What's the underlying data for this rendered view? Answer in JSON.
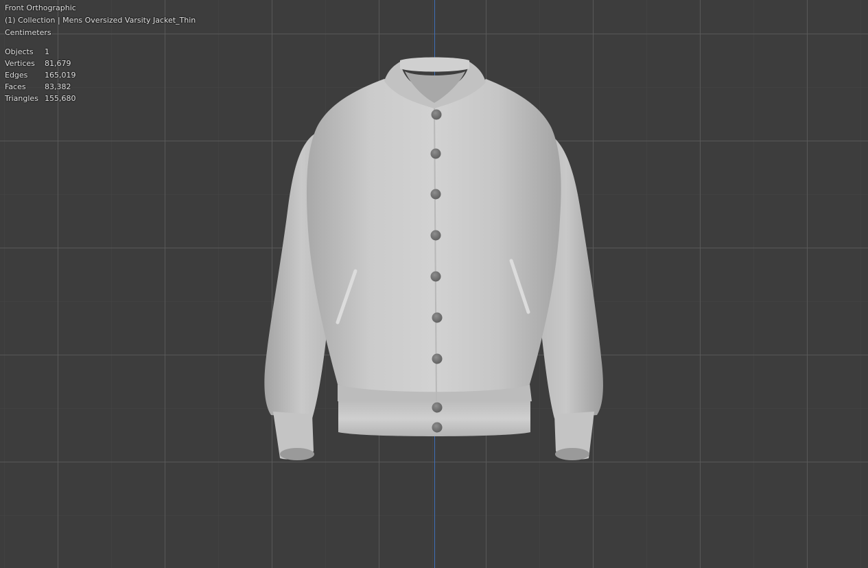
{
  "viewport": {
    "view_name": "Front Orthographic",
    "collection_line": "(1) Collection | Mens Oversized Varsity Jacket_Thin",
    "units": "Centimeters",
    "stats": [
      {
        "label": "Objects",
        "value": "1"
      },
      {
        "label": "Vertices",
        "value": "81,679"
      },
      {
        "label": "Edges",
        "value": "165,019"
      },
      {
        "label": "Faces",
        "value": "83,382"
      },
      {
        "label": "Triangles",
        "value": "155,680"
      }
    ],
    "colors": {
      "background": "#3d3d3d",
      "grid_major": "#5c5c5c",
      "z_axis": "#3f6fb8",
      "mesh": "#c8c8c8"
    },
    "model": {
      "icon": "jacket-mesh",
      "button_count": 9
    }
  }
}
